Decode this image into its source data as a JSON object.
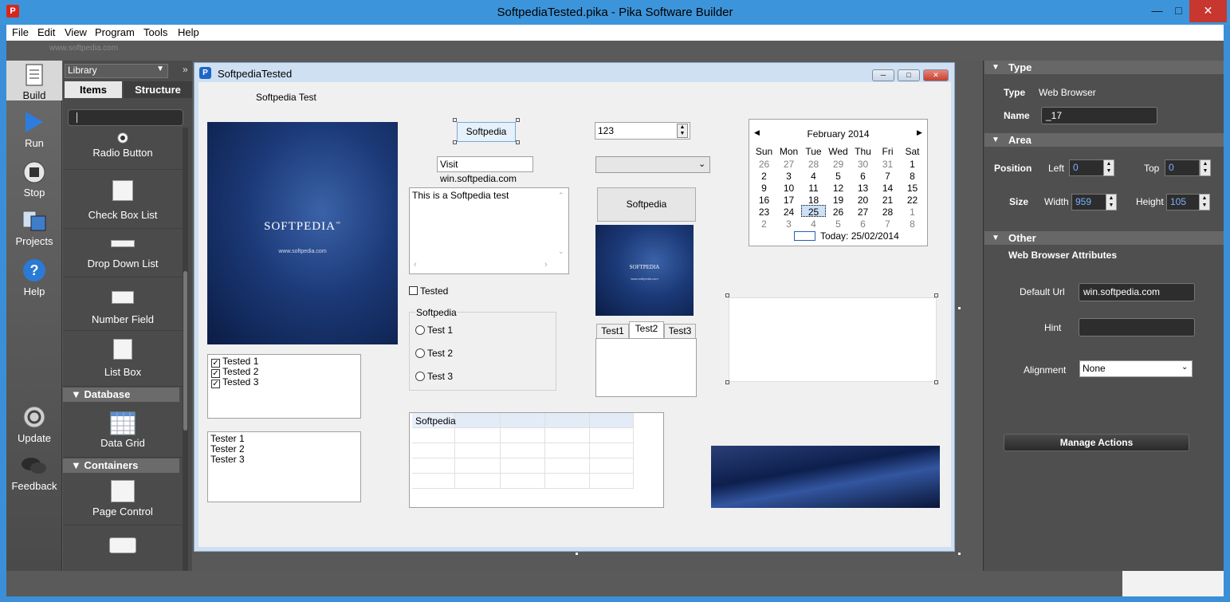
{
  "window": {
    "title": "SoftpediaTested.pika - Pika Software Builder",
    "app_icon": "P",
    "minimize": "—",
    "maximize": "□",
    "close": "✕"
  },
  "menu": [
    "File",
    "Edit",
    "View",
    "Program",
    "Tools",
    "Help"
  ],
  "watermark": "www.softpedia.com",
  "toolbar": {
    "build": "Build",
    "run": "Run",
    "stop": "Stop",
    "projects": "Projects",
    "help": "Help",
    "update": "Update",
    "feedback": "Feedback"
  },
  "library": {
    "dropdown": "Library",
    "more": "»",
    "tab_items": "Items",
    "tab_structure": "Structure",
    "items": [
      "Radio Button",
      "Check Box List",
      "Drop Down List",
      "Number Field",
      "List Box",
      "Data Grid",
      "Page Control"
    ],
    "section_database": "Database",
    "section_containers": "Containers"
  },
  "form": {
    "title": "SoftpediaTested",
    "icon": "P",
    "label_test": "Softpedia Test",
    "image_text": "SOFTPEDIA",
    "image_tm": "™",
    "image_url": "www.softpedia.com",
    "checklist": [
      "Tested 1",
      "Tested 2",
      "Tested 3"
    ],
    "listbox": [
      "Tester 1",
      "Tester 2",
      "Tester 3"
    ],
    "button_softpedia": "Softpedia",
    "link_visit": "Visit win.softpedia.com",
    "memo_text": "This is a Softpedia test",
    "checkbox_tested": "Tested",
    "radiogroup_caption": "Softpedia",
    "radios": [
      "Test 1",
      "Test 2",
      "Test 3"
    ],
    "grid_first_cell": "Softpedia",
    "number_value": "123",
    "button2": "Softpedia",
    "page_tabs": [
      "Test1",
      "Test2",
      "Test3"
    ],
    "calendar": {
      "month": "February 2014",
      "days": [
        "Sun",
        "Mon",
        "Tue",
        "Wed",
        "Thu",
        "Fri",
        "Sat"
      ],
      "weeks": [
        [
          "26",
          "27",
          "28",
          "29",
          "30",
          "31",
          "1"
        ],
        [
          "2",
          "3",
          "4",
          "5",
          "6",
          "7",
          "8"
        ],
        [
          "9",
          "10",
          "11",
          "12",
          "13",
          "14",
          "15"
        ],
        [
          "16",
          "17",
          "18",
          "19",
          "20",
          "21",
          "22"
        ],
        [
          "23",
          "24",
          "25",
          "26",
          "27",
          "28",
          "1"
        ],
        [
          "2",
          "3",
          "4",
          "5",
          "6",
          "7",
          "8"
        ]
      ],
      "selected": "25",
      "today": "Today: 25/02/2014"
    }
  },
  "properties": {
    "section_type": "Type",
    "type_label": "Type",
    "type_value": "Web Browser",
    "name_label": "Name",
    "name_value": "_17",
    "section_area": "Area",
    "position_label": "Position",
    "left_label": "Left",
    "left_value": "0",
    "top_label": "Top",
    "top_value": "0",
    "size_label": "Size",
    "width_label": "Width",
    "width_value": "959",
    "height_label": "Height",
    "height_value": "105",
    "section_other": "Other",
    "wb_attributes": "Web Browser Attributes",
    "default_url_label": "Default Url",
    "default_url_value": "win.softpedia.com",
    "hint_label": "Hint",
    "hint_value": "",
    "alignment_label": "Alignment",
    "alignment_value": "None",
    "manage_actions": "Manage Actions"
  }
}
